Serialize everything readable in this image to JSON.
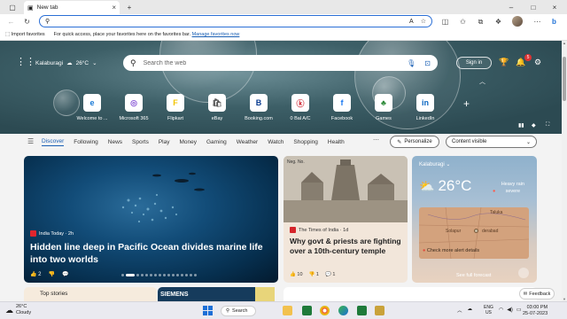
{
  "browser": {
    "tab_title": "New tab",
    "address_value": "",
    "favorites": {
      "import": "Import favorites",
      "message": "For quick access, place your favorites here on the favorites bar.",
      "manage_link": "Manage favorites now"
    }
  },
  "hero": {
    "location": "Kalaburagi",
    "temperature": "26°C",
    "search_placeholder": "Search the web",
    "signin": "Sign in",
    "notifications_count": "5"
  },
  "quick_links": [
    {
      "label": "Welcome to ...",
      "glyph": "e",
      "color": "#1b7ad6"
    },
    {
      "label": "Microsoft 365",
      "glyph": "◎",
      "color": "#8a59d6"
    },
    {
      "label": "Flipkart",
      "glyph": "F",
      "color": "#f2c400"
    },
    {
      "label": "eBay",
      "glyph": "🛍",
      "color": "#555"
    },
    {
      "label": "Booking.com",
      "glyph": "B",
      "color": "#0a3d91"
    },
    {
      "label": "0 Bal A/C",
      "glyph": "ⓚ",
      "color": "#cc1f2b"
    },
    {
      "label": "Facebook",
      "glyph": "f",
      "color": "#1877f2"
    },
    {
      "label": "Games",
      "glyph": "♣",
      "color": "#2e8b3a"
    },
    {
      "label": "LinkedIn",
      "glyph": "in",
      "color": "#0a66c2"
    }
  ],
  "nav": {
    "items": [
      "Discover",
      "Following",
      "News",
      "Sports",
      "Play",
      "Money",
      "Gaming",
      "Weather",
      "Watch",
      "Shopping",
      "Health"
    ],
    "personalize": "Personalize",
    "content_select": "Content visible"
  },
  "cards": {
    "main": {
      "source": "India Today · 2h",
      "headline": "Hidden line deep in Pacific Ocean divides marine life into two worlds",
      "likes": "2"
    },
    "temple": {
      "source": "The Times of India · 1d",
      "headline": "Why govt & priests are fighting over a 10th-century temple",
      "likes": "10",
      "dislikes": "1",
      "comments": "1"
    },
    "weather": {
      "location": "Kalaburagi",
      "temperature": "26°C",
      "alert": "Heavy rain severe",
      "map_labels": [
        "Taluka",
        "Solapur",
        "derabad"
      ],
      "more_alerts": "Check more alert details",
      "forecast": "See full forecast"
    }
  },
  "row2": {
    "top_stories": "Top stories",
    "siemens": "SIEMENS",
    "feedback": "Feedback"
  },
  "taskbar": {
    "weather_temp": "26°C",
    "weather_desc": "Cloudy",
    "search": "Search",
    "lang_top": "ENG",
    "lang_bottom": "US",
    "time": "03:00 PM",
    "date": "25-07-2023"
  },
  "colors": {
    "accent": "#1a5fb4",
    "hero": "#3d5f67",
    "edge_blue": "#2b6fd6"
  }
}
